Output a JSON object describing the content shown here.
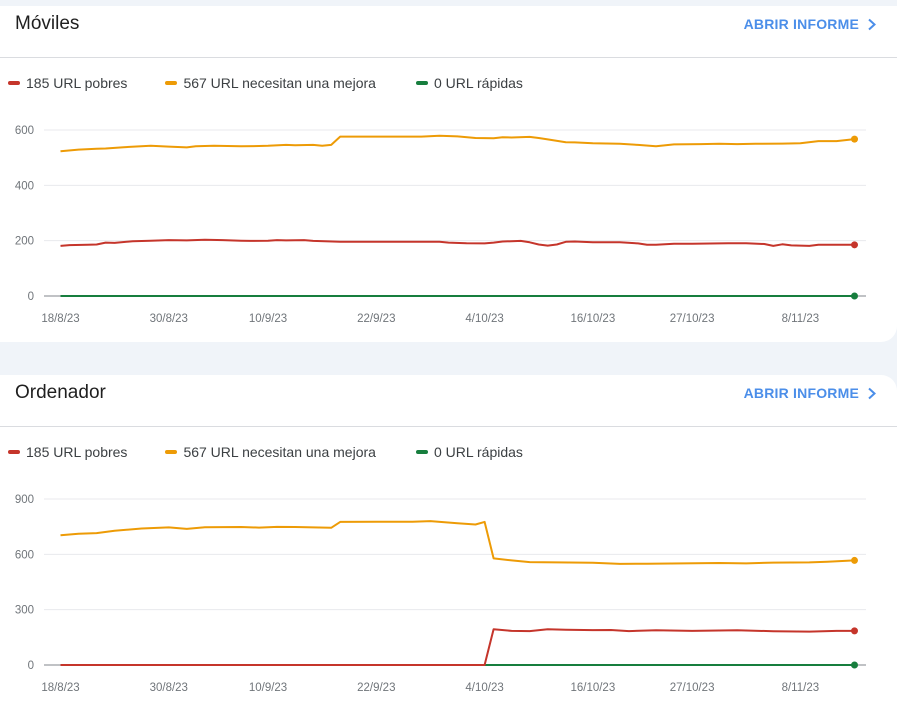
{
  "colors": {
    "poor": "#c5352b",
    "needs_improvement": "#ed9b06",
    "good": "#177e3e",
    "accent": "#4b8ee9"
  },
  "cards": [
    {
      "title": "Móviles",
      "action_label": "ABRIR INFORME",
      "action_icon": "chevron-right-icon",
      "legend": [
        {
          "label": "185 URL pobres",
          "color": "#c5352b"
        },
        {
          "label": "567 URL necesitan una mejora",
          "color": "#ed9b06"
        },
        {
          "label": "0 URL rápidas",
          "color": "#177e3e"
        }
      ]
    },
    {
      "title": "Ordenador",
      "action_label": "ABRIR INFORME",
      "action_icon": "chevron-right-icon",
      "legend": [
        {
          "label": "185 URL pobres",
          "color": "#c5352b"
        },
        {
          "label": "567 URL necesitan una mejora",
          "color": "#ed9b06"
        },
        {
          "label": "0 URL rápidas",
          "color": "#177e3e"
        }
      ]
    }
  ],
  "chart_data": [
    {
      "type": "line",
      "title": "Móviles",
      "x_start": "2023-08-18",
      "x_end": "2023-11-14",
      "x_tick_labels": [
        "18/8/23",
        "30/8/23",
        "10/9/23",
        "22/9/23",
        "4/10/23",
        "16/10/23",
        "27/10/23",
        "8/11/23"
      ],
      "x_tick_dates": [
        "2023-08-18",
        "2023-08-30",
        "2023-09-10",
        "2023-09-22",
        "2023-10-04",
        "2023-10-16",
        "2023-10-27",
        "2023-11-08"
      ],
      "ylim": [
        0,
        600
      ],
      "y_ticks": [
        0,
        200,
        400,
        600
      ],
      "grid": true,
      "legend_position": "top-left",
      "series": [
        {
          "name": "185 URL pobres",
          "color": "#c5352b",
          "points": [
            [
              "2023-08-18",
              181
            ],
            [
              "2023-08-19",
              184
            ],
            [
              "2023-08-21",
              185
            ],
            [
              "2023-08-22",
              186
            ],
            [
              "2023-08-23",
              193
            ],
            [
              "2023-08-24",
              192
            ],
            [
              "2023-08-26",
              198
            ],
            [
              "2023-08-28",
              200
            ],
            [
              "2023-08-30",
              202
            ],
            [
              "2023-09-01",
              201
            ],
            [
              "2023-09-03",
              203
            ],
            [
              "2023-09-05",
              202
            ],
            [
              "2023-09-07",
              200
            ],
            [
              "2023-09-08",
              199
            ],
            [
              "2023-09-10",
              200
            ],
            [
              "2023-09-11",
              202
            ],
            [
              "2023-09-12",
              201
            ],
            [
              "2023-09-14",
              202
            ],
            [
              "2023-09-15",
              199
            ],
            [
              "2023-09-18",
              196
            ],
            [
              "2023-09-20",
              196
            ],
            [
              "2023-09-23",
              196
            ],
            [
              "2023-09-26",
              196
            ],
            [
              "2023-09-29",
              196
            ],
            [
              "2023-09-30",
              193
            ],
            [
              "2023-10-02",
              191
            ],
            [
              "2023-10-04",
              190
            ],
            [
              "2023-10-05",
              193
            ],
            [
              "2023-10-06",
              197
            ],
            [
              "2023-10-08",
              199
            ],
            [
              "2023-10-09",
              194
            ],
            [
              "2023-10-10",
              186
            ],
            [
              "2023-10-11",
              182
            ],
            [
              "2023-10-12",
              186
            ],
            [
              "2023-10-13",
              196
            ],
            [
              "2023-10-14",
              197
            ],
            [
              "2023-10-16",
              194
            ],
            [
              "2023-10-19",
              194
            ],
            [
              "2023-10-21",
              190
            ],
            [
              "2023-10-22",
              185
            ],
            [
              "2023-10-23",
              185
            ],
            [
              "2023-10-25",
              189
            ],
            [
              "2023-10-27",
              189
            ],
            [
              "2023-10-31",
              191
            ],
            [
              "2023-11-02",
              191
            ],
            [
              "2023-11-04",
              188
            ],
            [
              "2023-11-05",
              181
            ],
            [
              "2023-11-06",
              187
            ],
            [
              "2023-11-07",
              183
            ],
            [
              "2023-11-09",
              181
            ],
            [
              "2023-11-10",
              185
            ],
            [
              "2023-11-12",
              185
            ],
            [
              "2023-11-14",
              185
            ]
          ]
        },
        {
          "name": "567 URL necesitan una mejora",
          "color": "#ed9b06",
          "points": [
            [
              "2023-08-18",
              523
            ],
            [
              "2023-08-20",
              529
            ],
            [
              "2023-08-22",
              532
            ],
            [
              "2023-08-23",
              533
            ],
            [
              "2023-08-25",
              538
            ],
            [
              "2023-08-28",
              543
            ],
            [
              "2023-08-30",
              540
            ],
            [
              "2023-09-01",
              537
            ],
            [
              "2023-09-02",
              541
            ],
            [
              "2023-09-04",
              543
            ],
            [
              "2023-09-07",
              541
            ],
            [
              "2023-09-09",
              542
            ],
            [
              "2023-09-10",
              543
            ],
            [
              "2023-09-12",
              546
            ],
            [
              "2023-09-13",
              545
            ],
            [
              "2023-09-15",
              546
            ],
            [
              "2023-09-16",
              543
            ],
            [
              "2023-09-17",
              546
            ],
            [
              "2023-09-18",
              576
            ],
            [
              "2023-09-21",
              576
            ],
            [
              "2023-09-24",
              576
            ],
            [
              "2023-09-27",
              576
            ],
            [
              "2023-09-29",
              579
            ],
            [
              "2023-10-01",
              577
            ],
            [
              "2023-10-03",
              571
            ],
            [
              "2023-10-05",
              570
            ],
            [
              "2023-10-06",
              574
            ],
            [
              "2023-10-07",
              573
            ],
            [
              "2023-10-09",
              575
            ],
            [
              "2023-10-10",
              571
            ],
            [
              "2023-10-11",
              566
            ],
            [
              "2023-10-13",
              556
            ],
            [
              "2023-10-14",
              555
            ],
            [
              "2023-10-16",
              552
            ],
            [
              "2023-10-19",
              550
            ],
            [
              "2023-10-21",
              546
            ],
            [
              "2023-10-23",
              541
            ],
            [
              "2023-10-25",
              548
            ],
            [
              "2023-10-28",
              549
            ],
            [
              "2023-10-30",
              550
            ],
            [
              "2023-11-01",
              549
            ],
            [
              "2023-11-03",
              550
            ],
            [
              "2023-11-06",
              551
            ],
            [
              "2023-11-08",
              552
            ],
            [
              "2023-11-10",
              560
            ],
            [
              "2023-11-12",
              560
            ],
            [
              "2023-11-14",
              567
            ]
          ]
        },
        {
          "name": "0 URL rápidas",
          "color": "#177e3e",
          "points": [
            [
              "2023-08-18",
              0
            ],
            [
              "2023-11-14",
              0
            ]
          ]
        }
      ]
    },
    {
      "type": "line",
      "title": "Ordenador",
      "x_start": "2023-08-18",
      "x_end": "2023-11-14",
      "x_tick_labels": [
        "18/8/23",
        "30/8/23",
        "10/9/23",
        "22/9/23",
        "4/10/23",
        "16/10/23",
        "27/10/23",
        "8/11/23"
      ],
      "x_tick_dates": [
        "2023-08-18",
        "2023-08-30",
        "2023-09-10",
        "2023-09-22",
        "2023-10-04",
        "2023-10-16",
        "2023-10-27",
        "2023-11-08"
      ],
      "ylim": [
        0,
        900
      ],
      "y_ticks": [
        0,
        300,
        600,
        900
      ],
      "grid": true,
      "legend_position": "top-left",
      "series": [
        {
          "name": "185 URL pobres",
          "color": "#c5352b",
          "points": [
            [
              "2023-08-18",
              0
            ],
            [
              "2023-10-04",
              0
            ],
            [
              "2023-10-05",
              194
            ],
            [
              "2023-10-07",
              185
            ],
            [
              "2023-10-09",
              184
            ],
            [
              "2023-10-11",
              194
            ],
            [
              "2023-10-13",
              191
            ],
            [
              "2023-10-16",
              189
            ],
            [
              "2023-10-18",
              190
            ],
            [
              "2023-10-20",
              184
            ],
            [
              "2023-10-23",
              188
            ],
            [
              "2023-10-27",
              185
            ],
            [
              "2023-11-01",
              188
            ],
            [
              "2023-11-05",
              183
            ],
            [
              "2023-11-09",
              181
            ],
            [
              "2023-11-12",
              185
            ],
            [
              "2023-11-14",
              185
            ]
          ]
        },
        {
          "name": "567 URL necesitan una mejora",
          "color": "#ed9b06",
          "points": [
            [
              "2023-08-18",
              703
            ],
            [
              "2023-08-20",
              712
            ],
            [
              "2023-08-22",
              715
            ],
            [
              "2023-08-24",
              728
            ],
            [
              "2023-08-27",
              740
            ],
            [
              "2023-08-30",
              746
            ],
            [
              "2023-09-01",
              738
            ],
            [
              "2023-09-03",
              747
            ],
            [
              "2023-09-07",
              748
            ],
            [
              "2023-09-09",
              745
            ],
            [
              "2023-09-11",
              749
            ],
            [
              "2023-09-13",
              748
            ],
            [
              "2023-09-15",
              746
            ],
            [
              "2023-09-17",
              744
            ],
            [
              "2023-09-18",
              776
            ],
            [
              "2023-09-22",
              777
            ],
            [
              "2023-09-26",
              777
            ],
            [
              "2023-09-28",
              780
            ],
            [
              "2023-10-01",
              768
            ],
            [
              "2023-10-03",
              762
            ],
            [
              "2023-10-04",
              776
            ],
            [
              "2023-10-05",
              578
            ],
            [
              "2023-10-07",
              567
            ],
            [
              "2023-10-09",
              558
            ],
            [
              "2023-10-12",
              556
            ],
            [
              "2023-10-16",
              554
            ],
            [
              "2023-10-19",
              548
            ],
            [
              "2023-10-22",
              549
            ],
            [
              "2023-10-26",
              551
            ],
            [
              "2023-10-30",
              553
            ],
            [
              "2023-11-02",
              551
            ],
            [
              "2023-11-05",
              555
            ],
            [
              "2023-11-09",
              556
            ],
            [
              "2023-11-11",
              560
            ],
            [
              "2023-11-14",
              567
            ]
          ]
        },
        {
          "name": "0 URL rápidas",
          "color": "#177e3e",
          "points": [
            [
              "2023-10-04",
              0
            ],
            [
              "2023-11-14",
              0
            ]
          ]
        }
      ]
    }
  ]
}
